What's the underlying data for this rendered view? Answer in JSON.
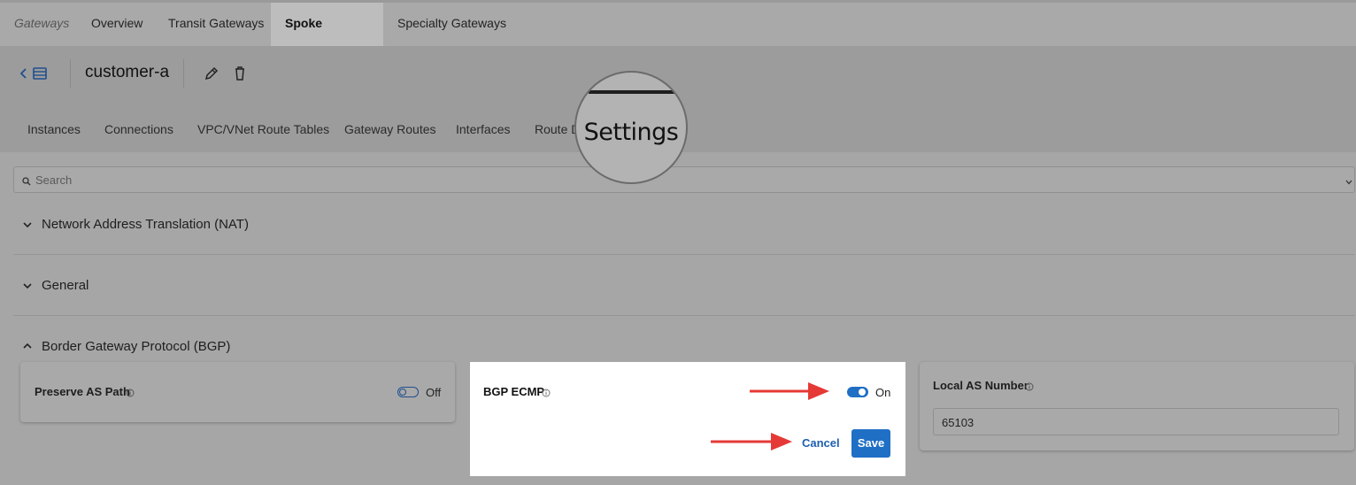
{
  "top_nav": {
    "breadcrumb": "Gateways",
    "tabs": [
      "Overview",
      "Transit Gateways",
      "Spoke Gateways",
      "Specialty Gateways"
    ],
    "active_tab": "Spoke Gateways"
  },
  "header": {
    "title": "customer-a"
  },
  "sub_tabs": [
    "Instances",
    "Connections",
    "VPC/VNet Route Tables",
    "Gateway Routes",
    "Interfaces",
    "Route D"
  ],
  "magnifier": {
    "label": "Settings"
  },
  "search": {
    "placeholder": "Search"
  },
  "sections": {
    "nat": "Network Address Translation (NAT)",
    "general": "General",
    "bgp": "Border Gateway Protocol (BGP)"
  },
  "bgp": {
    "preserve_as_path": {
      "label": "Preserve AS Path",
      "state": "Off"
    },
    "bgp_ecmp": {
      "label": "BGP ECMP",
      "state": "On"
    },
    "local_as": {
      "label": "Local AS Number",
      "value": "65103"
    },
    "cancel_label": "Cancel",
    "save_label": "Save"
  },
  "colors": {
    "accent": "#1f6fc5",
    "annotation_arrow": "#e53935"
  }
}
